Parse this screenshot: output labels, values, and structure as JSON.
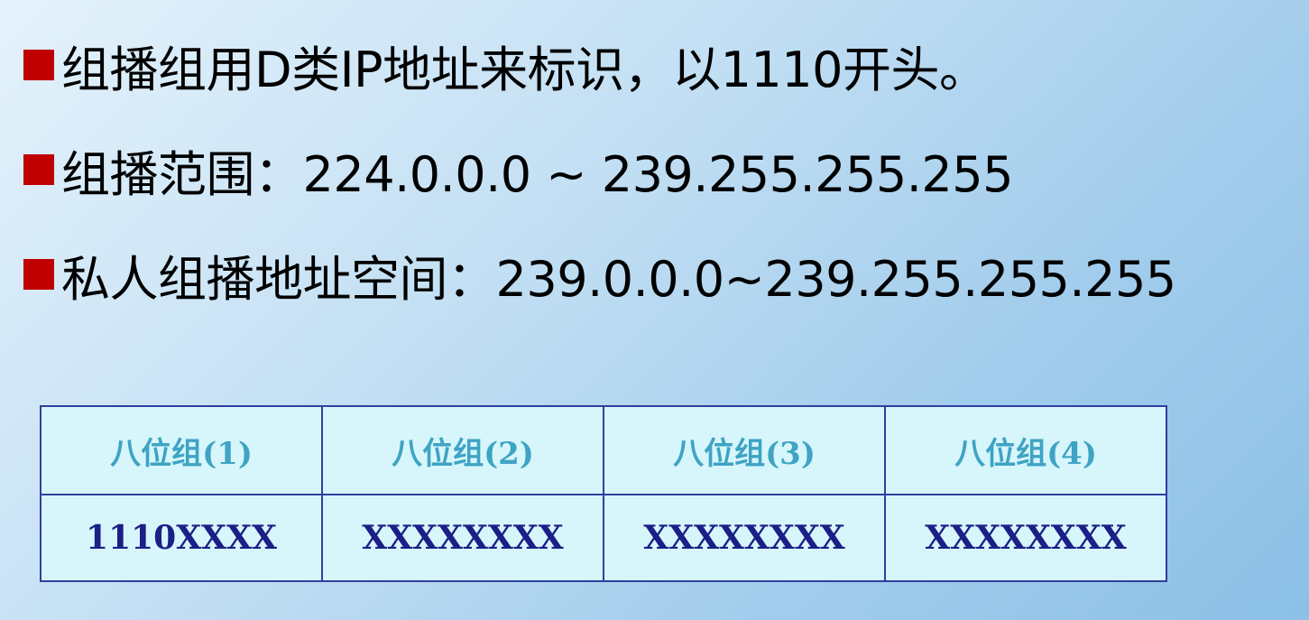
{
  "bullets": [
    {
      "text": "组播组用D类IP地址来标识，以1110开头。"
    },
    {
      "text": "组播范围：224.0.0.0  ~  239.255.255.255"
    },
    {
      "text": "私人组播地址空间：239.0.0.0~239.255.255.255"
    }
  ],
  "table": {
    "headers": [
      "八位组(1)",
      "八位组(2)",
      "八位组(3)",
      "八位组(4)"
    ],
    "values": [
      "1110XXXX",
      "XXXXXXXX",
      "XXXXXXXX",
      "XXXXXXXX"
    ]
  },
  "colors": {
    "bullet_square": "#c00000",
    "header_text": "#3fa3c4",
    "value_text": "#1b1f86",
    "table_border": "#2f3f9e",
    "table_fill": "#d6f6fb"
  }
}
